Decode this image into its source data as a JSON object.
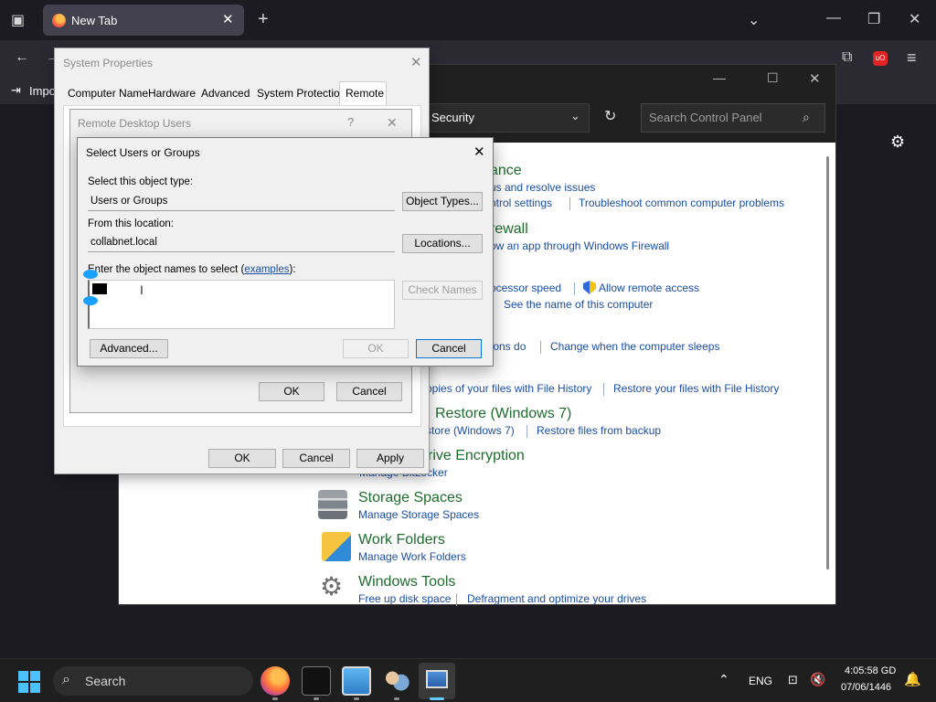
{
  "browser": {
    "tab_title": "New Tab",
    "bookmark_label": "Impo",
    "close_glyph": "✕",
    "new_tab_glyph": "+"
  },
  "control_panel": {
    "address_text": "Security",
    "search_placeholder": "Search Control Panel",
    "sections": [
      {
        "id": "maintenance",
        "title": "ance",
        "links": [
          "us and resolve issues",
          "ntrol settings",
          "Troubleshoot common computer problems"
        ]
      },
      {
        "id": "firewall",
        "title": "rewall",
        "links": [
          "ow an app through Windows Firewall"
        ]
      },
      {
        "id": "system",
        "title": "",
        "links": [
          "ocessor speed",
          "Allow remote access",
          "See the name of this computer"
        ]
      },
      {
        "id": "power",
        "title": "",
        "links": [
          "tons do",
          "Change when the computer sleeps"
        ]
      },
      {
        "id": "filehistory",
        "title": "",
        "links": [
          "opies of your files with File History",
          "Restore your files with File History"
        ]
      },
      {
        "id": "backup",
        "title": "Restore (Windows 7)",
        "links": [
          "store (Windows 7)",
          "Restore files from backup"
        ]
      },
      {
        "id": "bitlocker",
        "title": "rive Encryption",
        "links": [
          "Manage BitLocker"
        ]
      },
      {
        "id": "storage",
        "title": "Storage Spaces",
        "links": [
          "Manage Storage Spaces"
        ]
      },
      {
        "id": "workfolders",
        "title": "Work Folders",
        "links": [
          "Manage Work Folders"
        ]
      },
      {
        "id": "tools",
        "title": "Windows Tools",
        "links": [
          "Free up disk space",
          "Defragment and optimize your drives"
        ]
      }
    ]
  },
  "system_properties": {
    "title": "System Properties",
    "tabs": [
      "Computer Name",
      "Hardware",
      "Advanced",
      "System Protection",
      "Remote"
    ],
    "ok": "OK",
    "cancel": "Cancel",
    "apply": "Apply"
  },
  "remote_desktop_users": {
    "title": "Remote Desktop Users",
    "help": "?",
    "ok": "OK",
    "cancel": "Cancel"
  },
  "select_users": {
    "title": "Select Users or Groups",
    "object_type_label": "Select this object type:",
    "object_type_value": "Users or Groups",
    "object_types_btn": "Object Types...",
    "location_label": "From this location:",
    "location_value": "collabnet.local",
    "locations_btn": "Locations...",
    "names_label_prefix": "Enter the object names to select (",
    "names_label_link": "examples",
    "names_label_suffix": "):",
    "check_names_btn": "Check Names",
    "advanced_btn": "Advanced...",
    "ok": "OK",
    "cancel": "Cancel"
  },
  "taskbar": {
    "search_label": "Search",
    "language": "ENG",
    "time": "4:05:58 GD",
    "date": "07/06/1446"
  }
}
